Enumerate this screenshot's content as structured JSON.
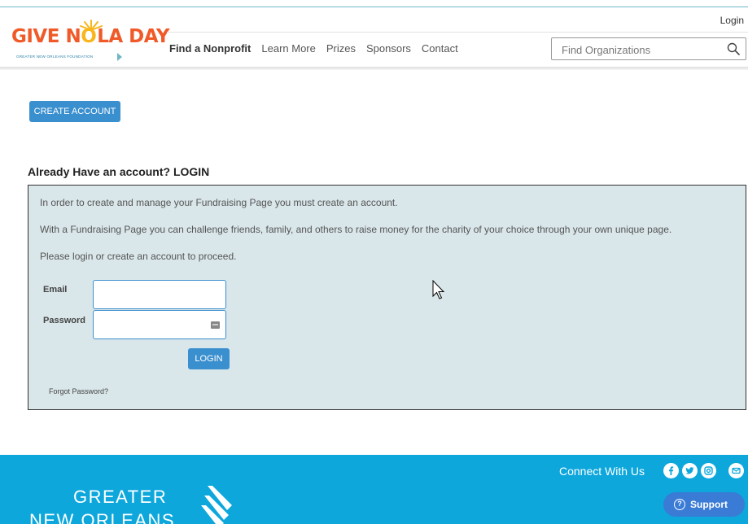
{
  "header": {
    "logo_text_before": "GIVE N",
    "logo_text_o": "O",
    "logo_text_after": "LA DAY",
    "logo_tagline": "GREATER NEW ORLEANS FOUNDATION",
    "login_label": "Login",
    "nav": [
      "Find a Nonprofit",
      "Learn More",
      "Prizes",
      "Sponsors",
      "Contact"
    ],
    "search_placeholder": "Find Organizations",
    "search_icon": "magnifier"
  },
  "main": {
    "create_account_label": "CREATE ACCOUNT",
    "section_title": "Already Have an account? LOGIN",
    "info_1": "In order to create and manage your Fundraising Page you must create an account.",
    "info_2": "With a Fundraising Page you can challenge friends, family, and others to raise money for the charity of your choice through your own unique page.",
    "info_3": "Please login or create an account to proceed.",
    "email_label": "Email",
    "email_value": "",
    "password_label": "Password",
    "password_value": "",
    "login_button": "LOGIN",
    "forgot_password": "Forgot Password?"
  },
  "footer": {
    "connect_label": "Connect With Us",
    "social_icons": [
      "facebook",
      "twitter",
      "instagram",
      "email"
    ],
    "logo_line1": "GREATER",
    "logo_line2": "NEW ORLEANS",
    "support_label": "Support"
  },
  "colors": {
    "brand_orange": "#f05a28",
    "brand_yellow": "#f8b61c",
    "button_blue": "#3a8fcf",
    "panel_bg": "#d9e6ea",
    "footer_bg": "#0da7dc",
    "support_bg": "#3a7bd5"
  }
}
